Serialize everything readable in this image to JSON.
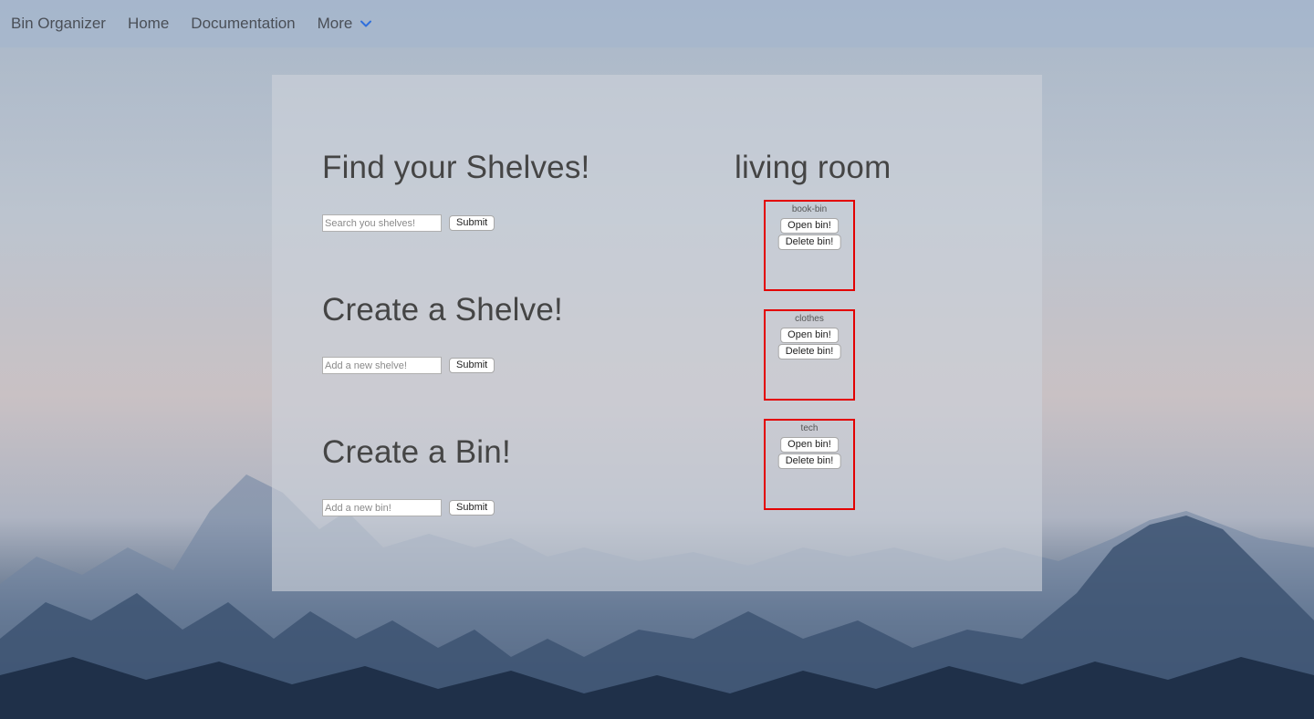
{
  "navbar": {
    "brand": "Bin Organizer",
    "links": [
      "Home",
      "Documentation"
    ],
    "more_label": "More"
  },
  "find_section": {
    "heading": "Find your Shelves!",
    "input_placeholder": "Search you shelves!",
    "submit_label": "Submit"
  },
  "create_shelve_section": {
    "heading": "Create a Shelve!",
    "input_placeholder": "Add a new shelve!",
    "submit_label": "Submit"
  },
  "create_bin_section": {
    "heading": "Create a Bin!",
    "input_placeholder": "Add a new bin!",
    "submit_label": "Submit"
  },
  "shelf": {
    "title": "living room",
    "bins": [
      {
        "name": "book-bin",
        "open_label": "Open bin!",
        "delete_label": "Delete bin!"
      },
      {
        "name": "clothes",
        "open_label": "Open bin!",
        "delete_label": "Delete bin!"
      },
      {
        "name": "tech",
        "open_label": "Open bin!",
        "delete_label": "Delete bin!"
      }
    ]
  },
  "colors": {
    "bin_border": "#e30000",
    "chevron": "#2f6fdc"
  }
}
